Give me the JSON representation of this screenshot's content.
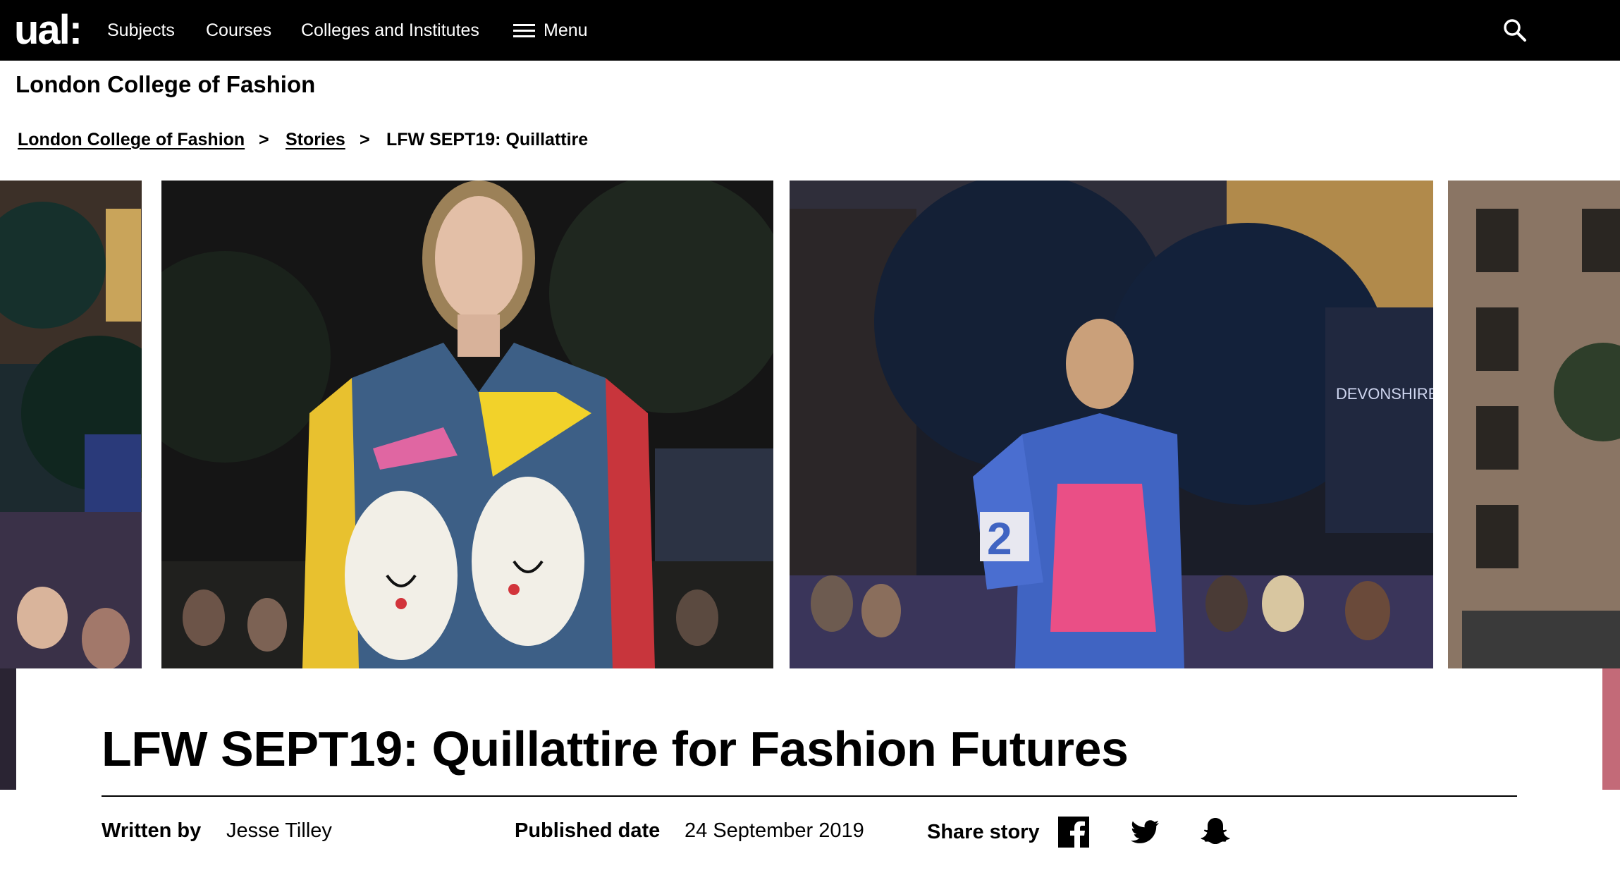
{
  "nav": {
    "logo": "ual:",
    "links": [
      "Subjects",
      "Courses",
      "Colleges and Institutes"
    ],
    "menu_label": "Menu",
    "search_icon": "search-icon"
  },
  "college": {
    "title": "London College of Fashion"
  },
  "breadcrumb": {
    "items": [
      "London College of Fashion",
      "Stories",
      "LFW SEPT19: Quillattire"
    ],
    "separator": ">"
  },
  "gallery": {
    "photos": [
      {
        "description_icon": "runway-photo"
      },
      {
        "description_icon": "runway-photo"
      },
      {
        "description_icon": "runway-photo"
      },
      {
        "description_icon": "building-photo"
      }
    ]
  },
  "article": {
    "title": "LFW SEPT19: Quillattire for Fashion Futures",
    "written_by_label": "Written by",
    "author": "Jesse Tilley",
    "published_label": "Published date",
    "published_date": "24 September 2019",
    "share_label": "Share story",
    "share_icons": [
      "facebook-icon",
      "twitter-icon",
      "snapchat-icon"
    ]
  },
  "colors": {
    "nav_bg": "#000000",
    "text": "#000000",
    "background": "#ffffff"
  }
}
